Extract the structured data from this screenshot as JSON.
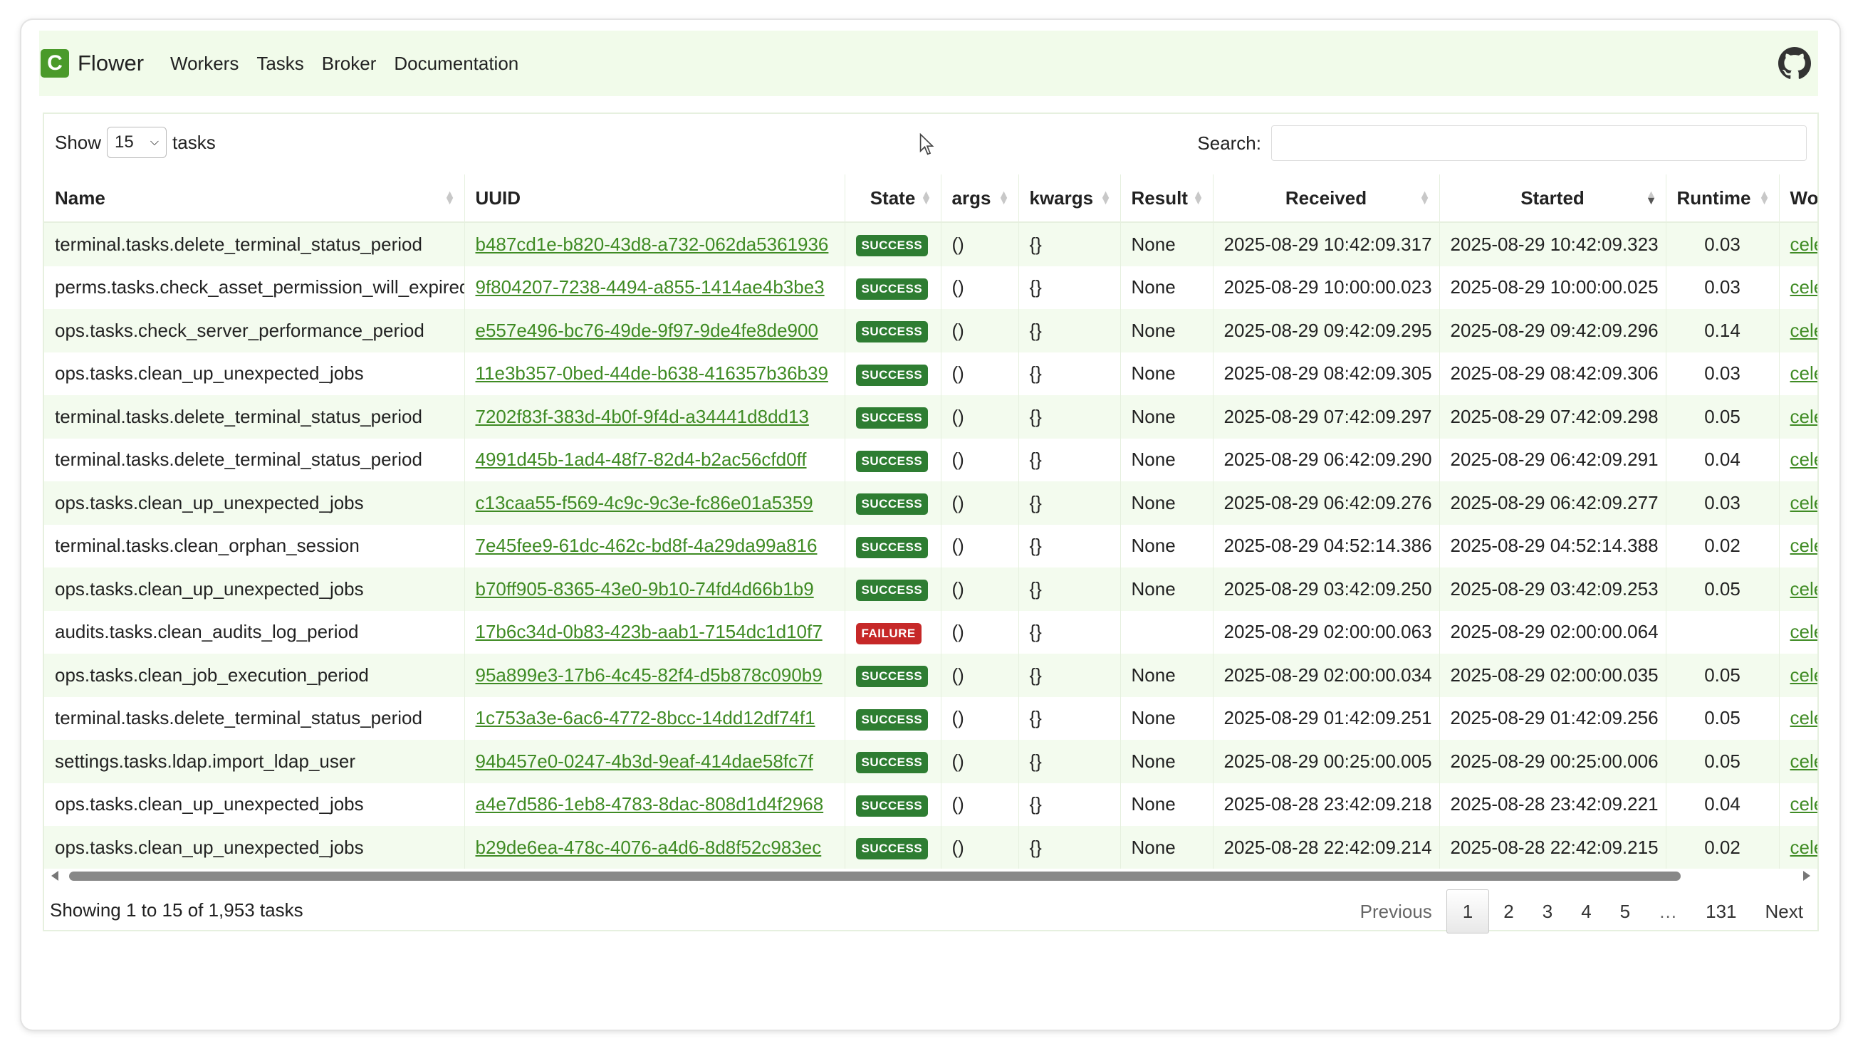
{
  "nav": {
    "brand": "Flower",
    "brand_letter": "C",
    "links": [
      "Workers",
      "Tasks",
      "Broker",
      "Documentation"
    ],
    "github_icon": "github-icon"
  },
  "controls": {
    "show_label": "Show",
    "show_value": "15",
    "tasks_label": "tasks",
    "search_label": "Search:",
    "search_value": ""
  },
  "table": {
    "columns": [
      "Name",
      "UUID",
      "State",
      "args",
      "kwargs",
      "Result",
      "Received",
      "Started",
      "Runtime",
      "Wo"
    ],
    "sorted_column": "Started",
    "sort_direction": "descending",
    "rows": [
      {
        "name": "terminal.tasks.delete_terminal_status_period",
        "uuid": "b487cd1e-b820-43d8-a732-062da5361936",
        "state": "SUCCESS",
        "args": "()",
        "kwargs": "{}",
        "result": "None",
        "received": "2025-08-29 10:42:09.317",
        "started": "2025-08-29 10:42:09.323",
        "runtime": "0.03",
        "worker": "cele"
      },
      {
        "name": "perms.tasks.check_asset_permission_will_expired",
        "uuid": "9f804207-7238-4494-a855-1414ae4b3be3",
        "state": "SUCCESS",
        "args": "()",
        "kwargs": "{}",
        "result": "None",
        "received": "2025-08-29 10:00:00.023",
        "started": "2025-08-29 10:00:00.025",
        "runtime": "0.03",
        "worker": "cele"
      },
      {
        "name": "ops.tasks.check_server_performance_period",
        "uuid": "e557e496-bc76-49de-9f97-9de4fe8de900",
        "state": "SUCCESS",
        "args": "()",
        "kwargs": "{}",
        "result": "None",
        "received": "2025-08-29 09:42:09.295",
        "started": "2025-08-29 09:42:09.296",
        "runtime": "0.14",
        "worker": "cele"
      },
      {
        "name": "ops.tasks.clean_up_unexpected_jobs",
        "uuid": "11e3b357-0bed-44de-b638-416357b36b39",
        "state": "SUCCESS",
        "args": "()",
        "kwargs": "{}",
        "result": "None",
        "received": "2025-08-29 08:42:09.305",
        "started": "2025-08-29 08:42:09.306",
        "runtime": "0.03",
        "worker": "cele"
      },
      {
        "name": "terminal.tasks.delete_terminal_status_period",
        "uuid": "7202f83f-383d-4b0f-9f4d-a34441d8dd13",
        "state": "SUCCESS",
        "args": "()",
        "kwargs": "{}",
        "result": "None",
        "received": "2025-08-29 07:42:09.297",
        "started": "2025-08-29 07:42:09.298",
        "runtime": "0.05",
        "worker": "cele"
      },
      {
        "name": "terminal.tasks.delete_terminal_status_period",
        "uuid": "4991d45b-1ad4-48f7-82d4-b2ac56cfd0ff",
        "state": "SUCCESS",
        "args": "()",
        "kwargs": "{}",
        "result": "None",
        "received": "2025-08-29 06:42:09.290",
        "started": "2025-08-29 06:42:09.291",
        "runtime": "0.04",
        "worker": "cele"
      },
      {
        "name": "ops.tasks.clean_up_unexpected_jobs",
        "uuid": "c13caa55-f569-4c9c-9c3e-fc86e01a5359",
        "state": "SUCCESS",
        "args": "()",
        "kwargs": "{}",
        "result": "None",
        "received": "2025-08-29 06:42:09.276",
        "started": "2025-08-29 06:42:09.277",
        "runtime": "0.03",
        "worker": "cele"
      },
      {
        "name": "terminal.tasks.clean_orphan_session",
        "uuid": "7e45fee9-61dc-462c-bd8f-4a29da99a816",
        "state": "SUCCESS",
        "args": "()",
        "kwargs": "{}",
        "result": "None",
        "received": "2025-08-29 04:52:14.386",
        "started": "2025-08-29 04:52:14.388",
        "runtime": "0.02",
        "worker": "cele"
      },
      {
        "name": "ops.tasks.clean_up_unexpected_jobs",
        "uuid": "b70ff905-8365-43e0-9b10-74fd4d66b1b9",
        "state": "SUCCESS",
        "args": "()",
        "kwargs": "{}",
        "result": "None",
        "received": "2025-08-29 03:42:09.250",
        "started": "2025-08-29 03:42:09.253",
        "runtime": "0.05",
        "worker": "cele"
      },
      {
        "name": "audits.tasks.clean_audits_log_period",
        "uuid": "17b6c34d-0b83-423b-aab1-7154dc1d10f7",
        "state": "FAILURE",
        "args": "()",
        "kwargs": "{}",
        "result": "",
        "received": "2025-08-29 02:00:00.063",
        "started": "2025-08-29 02:00:00.064",
        "runtime": "",
        "worker": "cele"
      },
      {
        "name": "ops.tasks.clean_job_execution_period",
        "uuid": "95a899e3-17b6-4c45-82f4-d5b878c090b9",
        "state": "SUCCESS",
        "args": "()",
        "kwargs": "{}",
        "result": "None",
        "received": "2025-08-29 02:00:00.034",
        "started": "2025-08-29 02:00:00.035",
        "runtime": "0.05",
        "worker": "cele"
      },
      {
        "name": "terminal.tasks.delete_terminal_status_period",
        "uuid": "1c753a3e-6ac6-4772-8bcc-14dd12df74f1",
        "state": "SUCCESS",
        "args": "()",
        "kwargs": "{}",
        "result": "None",
        "received": "2025-08-29 01:42:09.251",
        "started": "2025-08-29 01:42:09.256",
        "runtime": "0.05",
        "worker": "cele"
      },
      {
        "name": "settings.tasks.ldap.import_ldap_user",
        "uuid": "94b457e0-0247-4b3d-9eaf-414dae58fc7f",
        "state": "SUCCESS",
        "args": "()",
        "kwargs": "{}",
        "result": "None",
        "received": "2025-08-29 00:25:00.005",
        "started": "2025-08-29 00:25:00.006",
        "runtime": "0.05",
        "worker": "cele"
      },
      {
        "name": "ops.tasks.clean_up_unexpected_jobs",
        "uuid": "a4e7d586-1eb8-4783-8dac-808d1d4f2968",
        "state": "SUCCESS",
        "args": "()",
        "kwargs": "{}",
        "result": "None",
        "received": "2025-08-28 23:42:09.218",
        "started": "2025-08-28 23:42:09.221",
        "runtime": "0.04",
        "worker": "cele"
      },
      {
        "name": "ops.tasks.clean_up_unexpected_jobs",
        "uuid": "b29de6ea-478c-4076-a4d6-8d8f52c983ec",
        "state": "SUCCESS",
        "args": "()",
        "kwargs": "{}",
        "result": "None",
        "received": "2025-08-28 22:42:09.214",
        "started": "2025-08-28 22:42:09.215",
        "runtime": "0.02",
        "worker": "cele"
      }
    ]
  },
  "footer": {
    "info": "Showing 1 to 15 of 1,953 tasks",
    "pagination": {
      "previous": "Previous",
      "pages": [
        "1",
        "2",
        "3",
        "4",
        "5",
        "…",
        "131"
      ],
      "current": "1",
      "next": "Next"
    }
  },
  "colors": {
    "accent": "#3f8b24",
    "success": "#2e7d32",
    "failure": "#c62828",
    "navbar_bg": "#f1fbea",
    "stripe_bg": "#f3fbee"
  }
}
